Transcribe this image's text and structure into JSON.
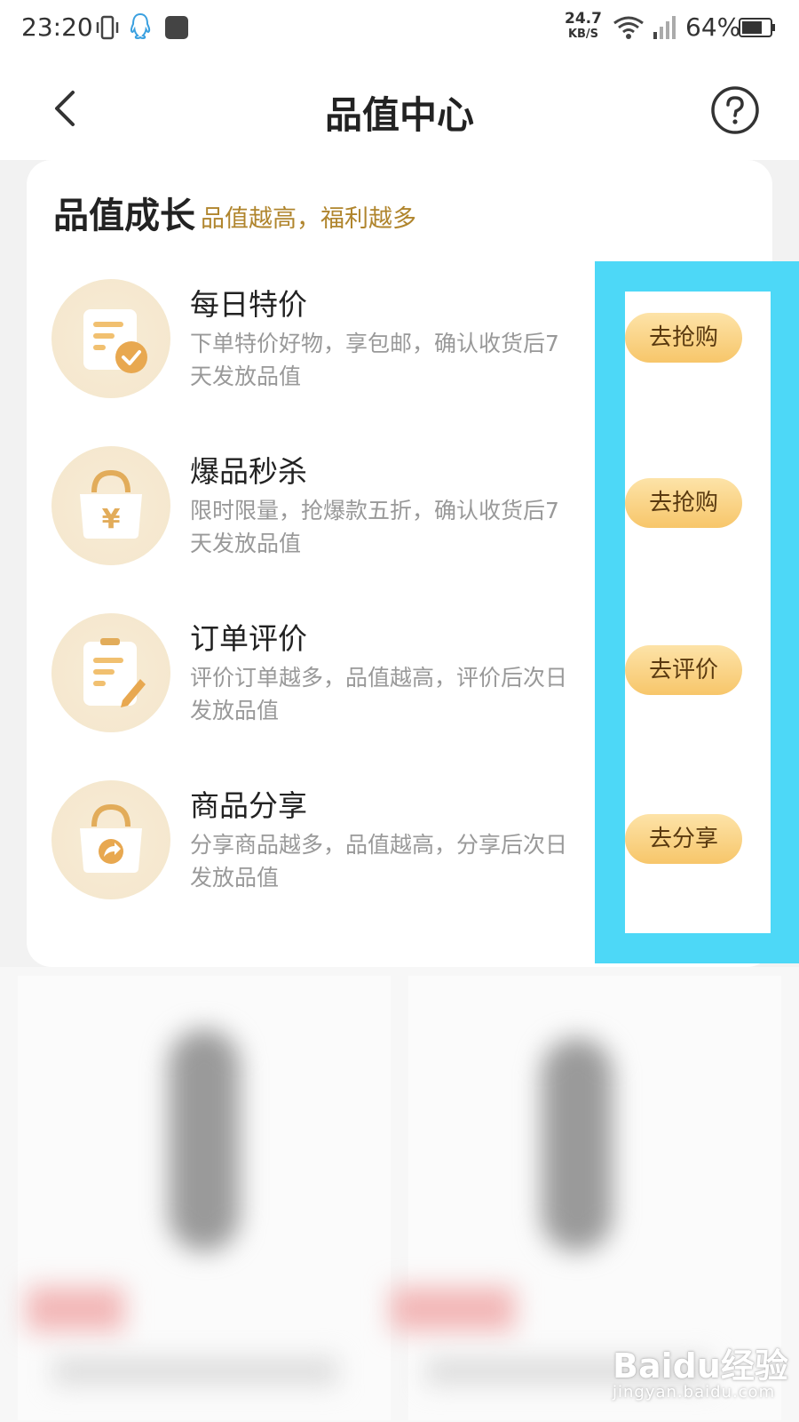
{
  "status_bar": {
    "time": "23:20",
    "net_speed_value": "24.7",
    "net_speed_unit": "KB/S",
    "battery": "64%",
    "icons": [
      "vibrate-icon",
      "qq-icon",
      "huawei-appgallery-icon",
      "wifi-icon",
      "signal-icon",
      "battery-icon"
    ]
  },
  "nav": {
    "title": "品值中心",
    "back_icon": "chevron-left-icon",
    "help_icon": "question-circle-icon"
  },
  "card": {
    "title": "品值成长",
    "subtitle": "品值越高，福利越多",
    "tasks": [
      {
        "name": "每日特价",
        "desc": "下单特价好物，享包邮，确认收货后7天发放品值",
        "button": "去抢购",
        "icon": "document-check-icon"
      },
      {
        "name": "爆品秒杀",
        "desc": "限时限量，抢爆款五折，确认收货后7天发放品值",
        "button": "去抢购",
        "icon": "shopping-bag-yen-icon"
      },
      {
        "name": "订单评价",
        "desc": "评价订单越多，品值越高，评价后次日发放品值",
        "button": "去评价",
        "icon": "clipboard-pen-icon"
      },
      {
        "name": "商品分享",
        "desc": "分享商品越多，品值越高，分享后次日发放品值",
        "button": "去分享",
        "icon": "shopping-bag-share-icon"
      }
    ]
  },
  "watermark": {
    "logo": "Baidu经验",
    "url": "jingyan.baidu.com"
  },
  "colors": {
    "accent_text": "#b0852d",
    "button_gradient_top": "#fde3a8",
    "button_gradient_bottom": "#f7c66a",
    "highlight": "#4dd8f7"
  }
}
